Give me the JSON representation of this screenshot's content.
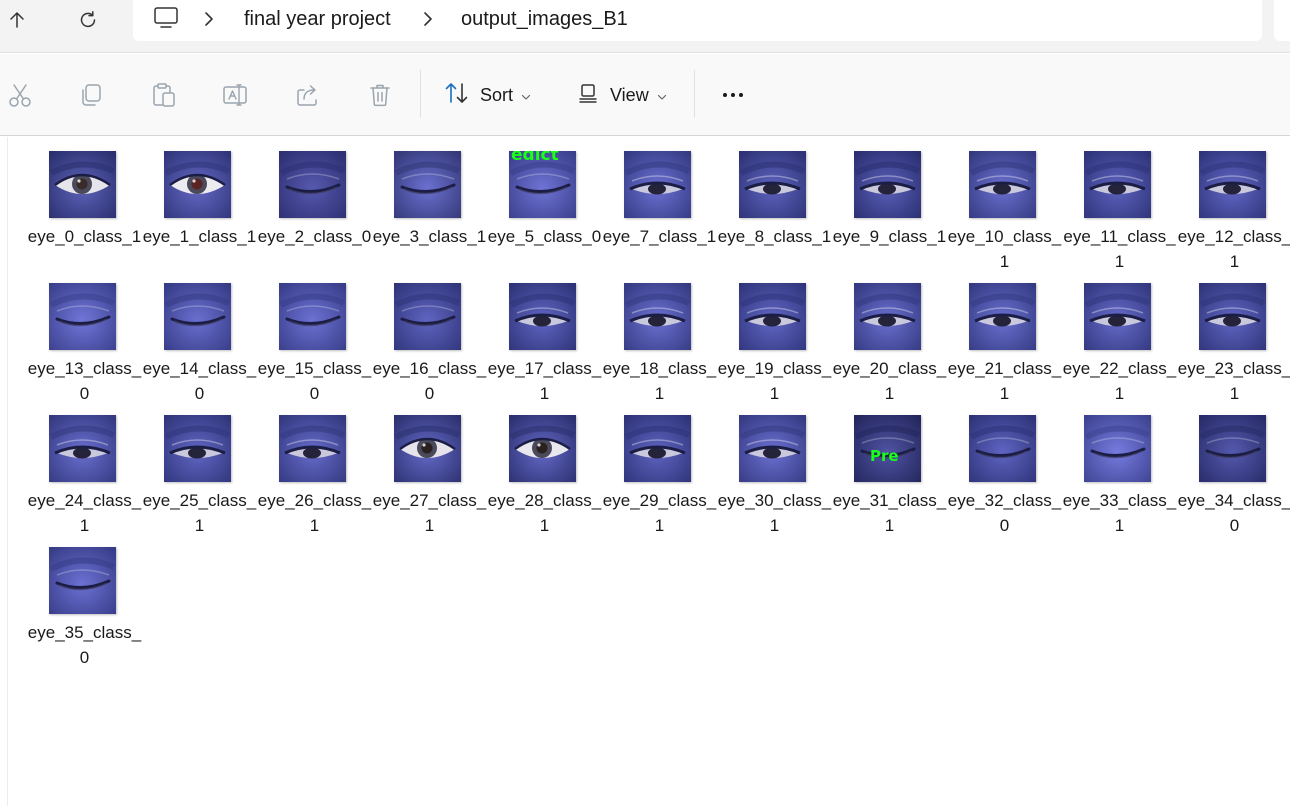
{
  "breadcrumb": {
    "items": [
      "final year project",
      "output_images_B1"
    ]
  },
  "toolbar": {
    "sort_label": "Sort",
    "view_label": "View"
  },
  "files": [
    {
      "name": "eye_0_class_1",
      "state": "open",
      "eye": "#e7e5ec",
      "skin": "#5d62b8",
      "dark": "#2a2f6e",
      "iris": "#3a2a2a"
    },
    {
      "name": "eye_1_class_1",
      "state": "open",
      "eye": "#ecebf0",
      "skin": "#6568c4",
      "dark": "#30357a",
      "iris": "#5a2424"
    },
    {
      "name": "eye_2_class_0",
      "state": "closed",
      "skin": "#5658ae",
      "dark": "#2d2f72"
    },
    {
      "name": "eye_3_class_1",
      "state": "closed",
      "skin": "#6b70d0",
      "dark": "#333877"
    },
    {
      "name": "eye_5_class_0",
      "state": "closed",
      "skin": "#6e73d4",
      "dark": "#3a3e8a",
      "overlay": "edict",
      "overlay_pos": "top"
    },
    {
      "name": "eye_7_class_1",
      "state": "half",
      "skin": "#6b70d2",
      "dark": "#343a82"
    },
    {
      "name": "eye_8_class_1",
      "state": "half",
      "skin": "#5e63bf",
      "dark": "#2d3275"
    },
    {
      "name": "eye_9_class_1",
      "state": "half",
      "skin": "#5a5fb8",
      "dark": "#2a2e70"
    },
    {
      "name": "eye_10_class_1",
      "state": "half",
      "skin": "#6a70cf",
      "dark": "#34397f"
    },
    {
      "name": "eye_11_class_1",
      "state": "half",
      "skin": "#5d62bf",
      "dark": "#2e3378"
    },
    {
      "name": "eye_12_class_1",
      "state": "half",
      "skin": "#6267c6",
      "dark": "#2f347a"
    },
    {
      "name": "eye_13_class_0",
      "state": "closed",
      "skin": "#7076d8",
      "dark": "#3a3f8c"
    },
    {
      "name": "eye_14_class_0",
      "state": "closed",
      "skin": "#6a6fd0",
      "dark": "#363b85"
    },
    {
      "name": "eye_15_class_0",
      "state": "closed",
      "skin": "#6c71d3",
      "dark": "#383d88"
    },
    {
      "name": "eye_16_class_0",
      "state": "closed",
      "skin": "#5f64c0",
      "dark": "#30357a"
    },
    {
      "name": "eye_17_class_1",
      "state": "half",
      "skin": "#6065c3",
      "dark": "#2e3377"
    },
    {
      "name": "eye_18_class_1",
      "state": "half",
      "skin": "#6b70d1",
      "dark": "#353a82"
    },
    {
      "name": "eye_19_class_1",
      "state": "half",
      "skin": "#6166c5",
      "dark": "#30357b"
    },
    {
      "name": "eye_20_class_1",
      "state": "half",
      "skin": "#6a6fcf",
      "dark": "#343980"
    },
    {
      "name": "eye_21_class_1",
      "state": "half",
      "skin": "#6a70d0",
      "dark": "#343a81"
    },
    {
      "name": "eye_22_class_1",
      "state": "half",
      "skin": "#666bca",
      "dark": "#32377e"
    },
    {
      "name": "eye_23_class_1",
      "state": "half",
      "skin": "#6065c2",
      "dark": "#2f3479"
    },
    {
      "name": "eye_24_class_1",
      "state": "half",
      "skin": "#6a6fcf",
      "dark": "#343980"
    },
    {
      "name": "eye_25_class_1",
      "state": "half",
      "skin": "#6166c4",
      "dark": "#30357a"
    },
    {
      "name": "eye_26_class_1",
      "state": "half",
      "skin": "#666bcb",
      "dark": "#33387e"
    },
    {
      "name": "eye_27_class_1",
      "state": "open",
      "eye": "#e6e4ea",
      "skin": "#6469c8",
      "dark": "#2c316f",
      "iris": "#2a2020"
    },
    {
      "name": "eye_28_class_1",
      "state": "open",
      "eye": "#e9e7ee",
      "skin": "#6368c6",
      "dark": "#2b2f6e",
      "iris": "#2a2020"
    },
    {
      "name": "eye_29_class_1",
      "state": "half",
      "skin": "#5f64c1",
      "dark": "#2e3378"
    },
    {
      "name": "eye_30_class_1",
      "state": "half",
      "skin": "#6b70d1",
      "dark": "#353a82"
    },
    {
      "name": "eye_31_class_1",
      "state": "closed",
      "skin": "#4f53a2",
      "dark": "#23265c",
      "overlay": "Pre",
      "overlay_pos": "mid"
    },
    {
      "name": "eye_32_class_0",
      "state": "closed",
      "skin": "#5f64c2",
      "dark": "#2e3378"
    },
    {
      "name": "eye_33_class_1",
      "state": "closed",
      "skin": "#767cdf",
      "dark": "#3d4290"
    },
    {
      "name": "eye_34_class_0",
      "state": "closed",
      "skin": "#5559ad",
      "dark": "#272b68"
    },
    {
      "name": "eye_35_class_0",
      "state": "closed",
      "skin": "#6c71d4",
      "dark": "#373c87"
    }
  ]
}
